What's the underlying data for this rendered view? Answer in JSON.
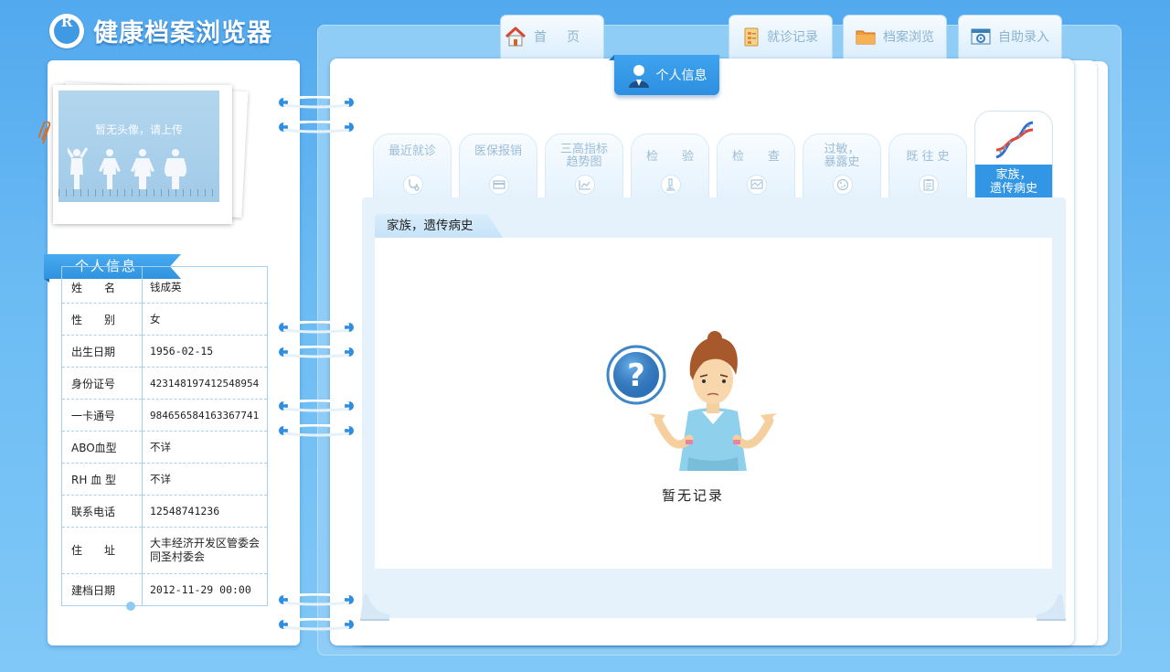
{
  "app": {
    "title": "健康档案浏览器",
    "logo_letter": "R"
  },
  "top_nav": {
    "home": "首页",
    "visits": "就诊记录",
    "browse": "档案浏览",
    "entry": "自助录入",
    "personal": "个人信息"
  },
  "avatar": {
    "placeholder": "暂无头像，请上传"
  },
  "personal_info": {
    "title": "个人信息",
    "rows": [
      {
        "label": "姓　　名",
        "value": "钱成英"
      },
      {
        "label": "性　　别",
        "value": "女"
      },
      {
        "label": "出生日期",
        "value": "1956-02-15"
      },
      {
        "label": "身份证号",
        "value": "423148197412548954"
      },
      {
        "label": "一卡通号",
        "value": "984656584163367741"
      },
      {
        "label": "ABO血型",
        "value": "不详"
      },
      {
        "label": "RH 血 型",
        "value": "不详"
      },
      {
        "label": "联系电话",
        "value": "12548741236"
      },
      {
        "label": "住　　址",
        "value": "大丰经济开发区管委会同圣村委会"
      },
      {
        "label": "建档日期",
        "value": "2012-11-29 00:00"
      }
    ]
  },
  "sub_tabs": [
    {
      "label": "最近就诊",
      "icon": "stethoscope-icon"
    },
    {
      "label": "医保报销",
      "icon": "card-icon"
    },
    {
      "label": "三高指标\n趋势图",
      "icon": "chart-icon"
    },
    {
      "label": "检　　验",
      "icon": "microscope-icon"
    },
    {
      "label": "检　　查",
      "icon": "monitor-icon"
    },
    {
      "label": "过敏，\n暴露史",
      "icon": "allergy-icon"
    },
    {
      "label": "既 往 史",
      "icon": "clipboard-icon"
    },
    {
      "label": "家族，\n遗传病史",
      "icon": "dna-icon",
      "active": true
    }
  ],
  "content": {
    "tab_title": "家族，遗传病史",
    "empty_text": "暂无记录"
  },
  "colors": {
    "accent": "#3296e4",
    "background": "#5aaeee"
  }
}
